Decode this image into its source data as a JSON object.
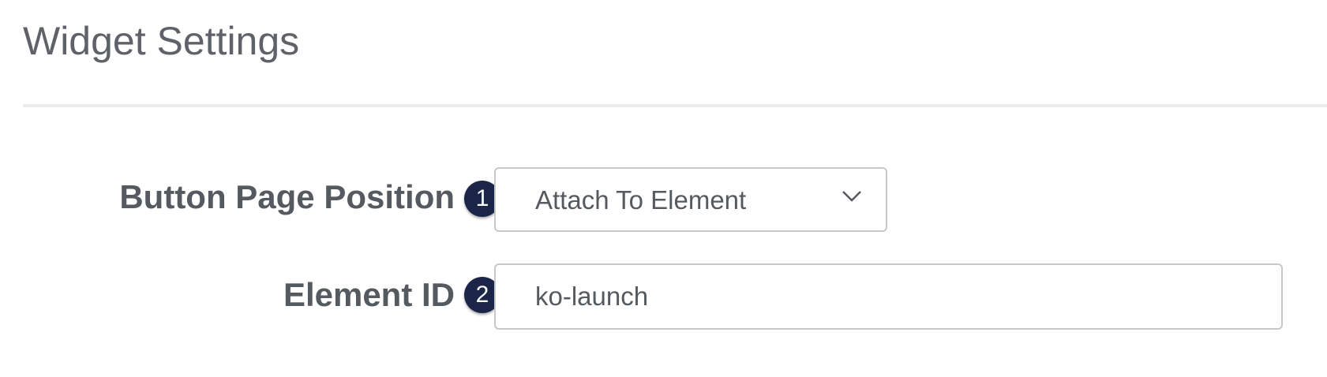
{
  "page": {
    "title": "Widget Settings"
  },
  "form": {
    "fields": [
      {
        "label": "Button Page Position",
        "step": "1",
        "type": "select",
        "value": "Attach To Element"
      },
      {
        "label": "Element ID",
        "step": "2",
        "type": "text",
        "value": "ko-launch"
      }
    ]
  },
  "icons": {
    "select_chevron": "chevron-down-icon"
  },
  "colors": {
    "badge_background": "#1b2547",
    "badge_text": "#ffffff",
    "label_text": "#555a60",
    "divider": "#ececec",
    "input_border": "#c8c8c8"
  }
}
